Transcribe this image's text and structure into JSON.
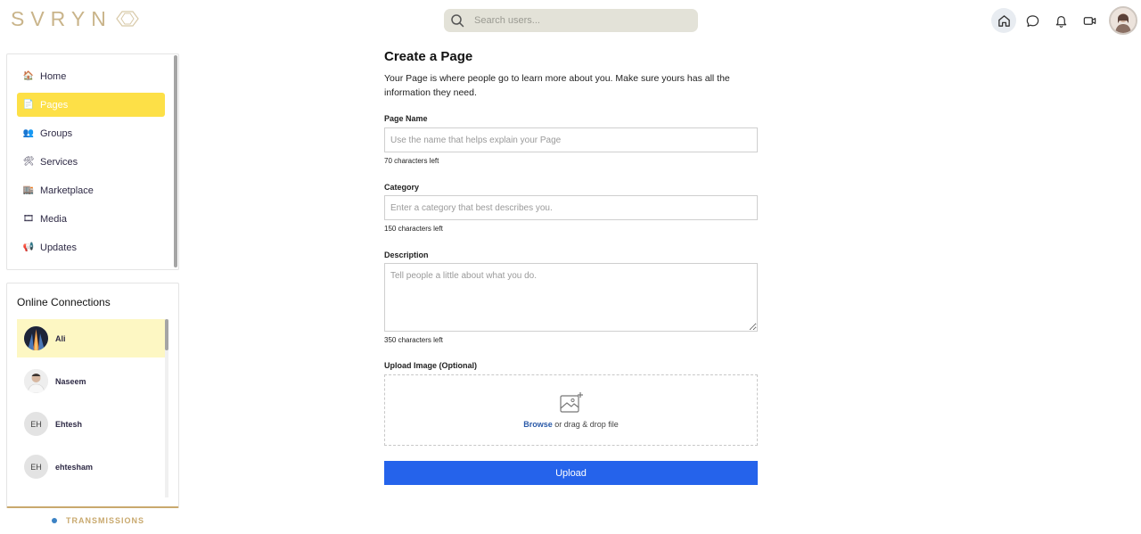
{
  "header": {
    "logo_text": "SVRYN",
    "search_placeholder": "Search users...",
    "icons": [
      "home-icon",
      "chat-icon",
      "bell-icon",
      "video-icon"
    ]
  },
  "sidebar": {
    "items": [
      {
        "label": "Home",
        "icon": "house-emoji",
        "selected": false
      },
      {
        "label": "Pages",
        "icon": "page-emoji",
        "selected": true
      },
      {
        "label": "Groups",
        "icon": "people-emoji",
        "selected": false
      },
      {
        "label": "Services",
        "icon": "tools-emoji",
        "selected": false
      },
      {
        "label": "Marketplace",
        "icon": "store-emoji",
        "selected": false
      },
      {
        "label": "Media",
        "icon": "film-emoji",
        "selected": false
      },
      {
        "label": "Updates",
        "icon": "megaphone-emoji",
        "selected": false
      }
    ]
  },
  "connections": {
    "title": "Online Connections",
    "people": [
      {
        "name": "Ali",
        "initials": "",
        "selected": true
      },
      {
        "name": "Naseem",
        "initials": "",
        "selected": false
      },
      {
        "name": "Ehtesh",
        "initials": "EH",
        "selected": false
      },
      {
        "name": "ehtesham",
        "initials": "EH",
        "selected": false
      }
    ]
  },
  "footer": {
    "transmissions": "TRANSMISSIONS"
  },
  "form": {
    "title": "Create a Page",
    "intro": "Your Page is where people go to learn more about you. Make sure yours has all the information they need.",
    "page_name": {
      "label": "Page Name",
      "placeholder": "Use the name that helps explain your Page",
      "hint": "70 characters left"
    },
    "category": {
      "label": "Category",
      "placeholder": "Enter a category that best describes you.",
      "hint": "150 characters left"
    },
    "description": {
      "label": "Description",
      "placeholder": "Tell people a little about what you do.",
      "hint": "350 characters left"
    },
    "upload_image": {
      "label": "Upload Image (Optional)",
      "browse": "Browse",
      "rest": " or drag & drop file"
    },
    "upload_button": "Upload"
  },
  "colors": {
    "accent": "#fde047",
    "primary": "#2563eb",
    "gold": "#c9a96e"
  }
}
